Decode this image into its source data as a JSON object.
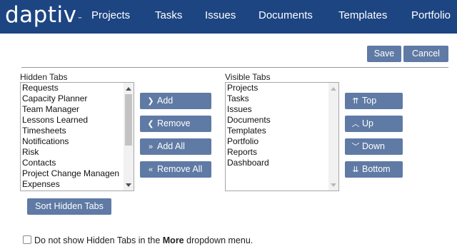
{
  "header": {
    "logo": "daptiv",
    "logo_mark": "™",
    "nav": [
      "Projects",
      "Tasks",
      "Issues",
      "Documents",
      "Templates",
      "Portfolio"
    ]
  },
  "actions": {
    "save": "Save",
    "cancel": "Cancel"
  },
  "hidden_tabs": {
    "label": "Hidden Tabs",
    "items": [
      "Requests",
      "Capacity Planner",
      "Team Manager",
      "Lessons Learned",
      "Timesheets",
      "Notifications",
      "Risk",
      "Contacts",
      "Project Change Managen",
      "Expenses"
    ]
  },
  "visible_tabs": {
    "label": "Visible Tabs",
    "items": [
      "Projects",
      "Tasks",
      "Issues",
      "Documents",
      "Templates",
      "Portfolio",
      "Reports",
      "Dashboard"
    ]
  },
  "transfer": {
    "add": "Add",
    "remove": "Remove",
    "add_all": "Add All",
    "remove_all": "Remove All"
  },
  "order": {
    "top": "Top",
    "up": "Up",
    "down": "Down",
    "bottom": "Bottom"
  },
  "sort_button": "Sort Hidden Tabs",
  "checkbox": {
    "checked": false,
    "text_before": "Do not show Hidden Tabs in the",
    "text_bold": "More",
    "text_after": "dropdown menu."
  },
  "colors": {
    "header_bg": "#1d4582",
    "button_bg": "#5f7aa4"
  }
}
